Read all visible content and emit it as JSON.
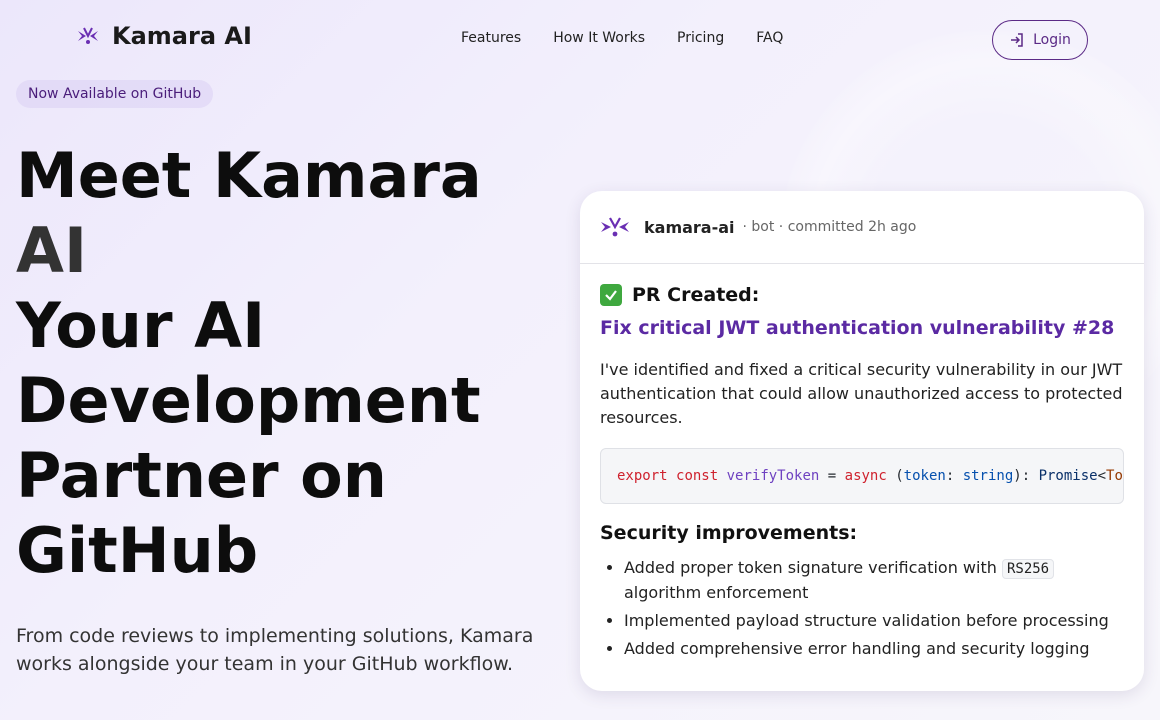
{
  "brand": {
    "name": "Kamara AI"
  },
  "nav": {
    "items": [
      "Features",
      "How It Works",
      "Pricing",
      "FAQ"
    ],
    "login_label": "Login"
  },
  "hero": {
    "badge": "Now Available on GitHub",
    "title_line1": "Meet Kamara",
    "title_line2": "AI",
    "title_line3": "Your AI",
    "title_line4": "Development",
    "title_line5": "Partner on",
    "title_line6": "GitHub",
    "subtitle": "From code reviews to implementing solutions, Kamara works alongside your team in your GitHub workflow."
  },
  "card": {
    "user": "kamara-ai",
    "meta": "· bot · committed 2h ago",
    "pr_label": "PR Created:",
    "pr_title": "Fix critical JWT authentication vulnerability #28",
    "description": "I've identified and fixed a critical security vulnerability in our JWT authentication that could allow unauthorized access to protected resources.",
    "code": {
      "t1": "export",
      "t2": "const",
      "t3": "verifyToken",
      "t4": "=",
      "t5": "async",
      "t6": "(",
      "t7": "token",
      "t8": ":",
      "t9": "string",
      "t10": "):",
      "t11": "Promise",
      "t12": "<",
      "t13": "To"
    },
    "security_title": "Security improvements:",
    "item1_pre": "Added proper token signature verification with",
    "item1_code": "RS256",
    "item1_post": "algorithm enforcement",
    "item2": "Implemented payload structure validation before processing",
    "item3": "Added comprehensive error handling and security logging"
  },
  "colors": {
    "accent": "#5b2aa3",
    "brand": "#6a2fb3",
    "check": "#3fa83f"
  }
}
